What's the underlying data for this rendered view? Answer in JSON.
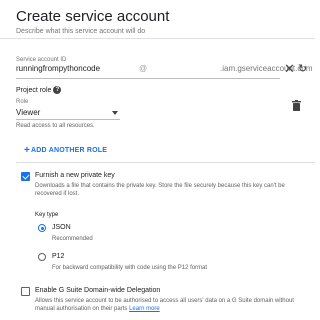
{
  "dialog": {
    "title": "Create service account",
    "cut_description": "Describe what this service account will do"
  },
  "service_account_id": {
    "label": "Service account ID",
    "value": "runningfrompythoncode",
    "at": "@",
    "domain": ".iam.gserviceaccount.com",
    "clear_icon": "close-icon",
    "refresh_icon": "refresh-icon"
  },
  "project_role": {
    "heading": "Project role",
    "role_label": "Role",
    "role_value": "Viewer",
    "role_help": "Read access to all resources.",
    "add_button": "ADD ANOTHER ROLE"
  },
  "private_key": {
    "checked": true,
    "title": "Furnish a new private key",
    "description": "Downloads a file that contains the private key. Store the file securely because this key can't be recovered if lost.",
    "key_type_label": "Key type",
    "options": [
      {
        "label": "JSON",
        "description": "Recommended",
        "selected": true
      },
      {
        "label": "P12",
        "description": "For backward compatibility with code using the P12 format",
        "selected": false
      }
    ]
  },
  "gsuite": {
    "checked": false,
    "title": "Enable G Suite Domain-wide Delegation",
    "description": "Allows this service account to be authorised to access all users' data on a G Suite domain without manual authorisation on their parts",
    "link": "Learn more"
  },
  "colors": {
    "accent": "#1a73e8",
    "text": "#212121",
    "muted": "#757575"
  }
}
